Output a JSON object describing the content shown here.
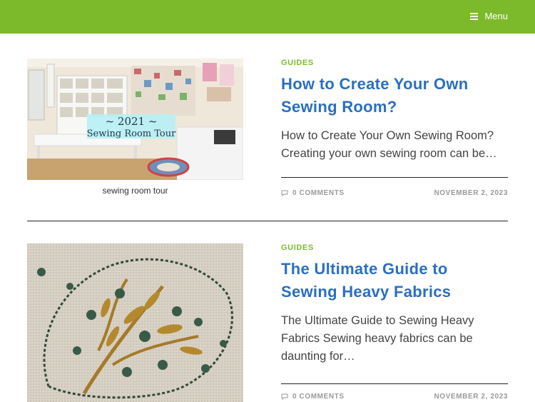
{
  "header": {
    "menu_label": "Menu",
    "bar_color": "#7dba2b"
  },
  "posts": [
    {
      "category": "GUIDES",
      "title": "How to Create Your Own Sewing Room?",
      "excerpt": "How to Create Your Own Sewing Room? Creating your own sewing room can be…",
      "comments": "0 COMMENTS",
      "date": "NOVEMBER 2, 2023",
      "image_caption": "sewing room tour",
      "image_text_line1": "~ 2021 ~",
      "image_text_line2": "Sewing Room Tour"
    },
    {
      "category": "GUIDES",
      "title": "The Ultimate Guide to Sewing Heavy Fabrics",
      "excerpt": "The Ultimate Guide to Sewing Heavy Fabrics Sewing heavy fabrics can be daunting for…",
      "comments": "0 COMMENTS",
      "date": "NOVEMBER 2, 2023"
    }
  ],
  "colors": {
    "accent_green": "#7dba2b",
    "title_blue": "#2a6fc0",
    "meta_gray": "#999999"
  },
  "icons": [
    "hamburger-menu-icon",
    "comment-bubble-icon"
  ]
}
